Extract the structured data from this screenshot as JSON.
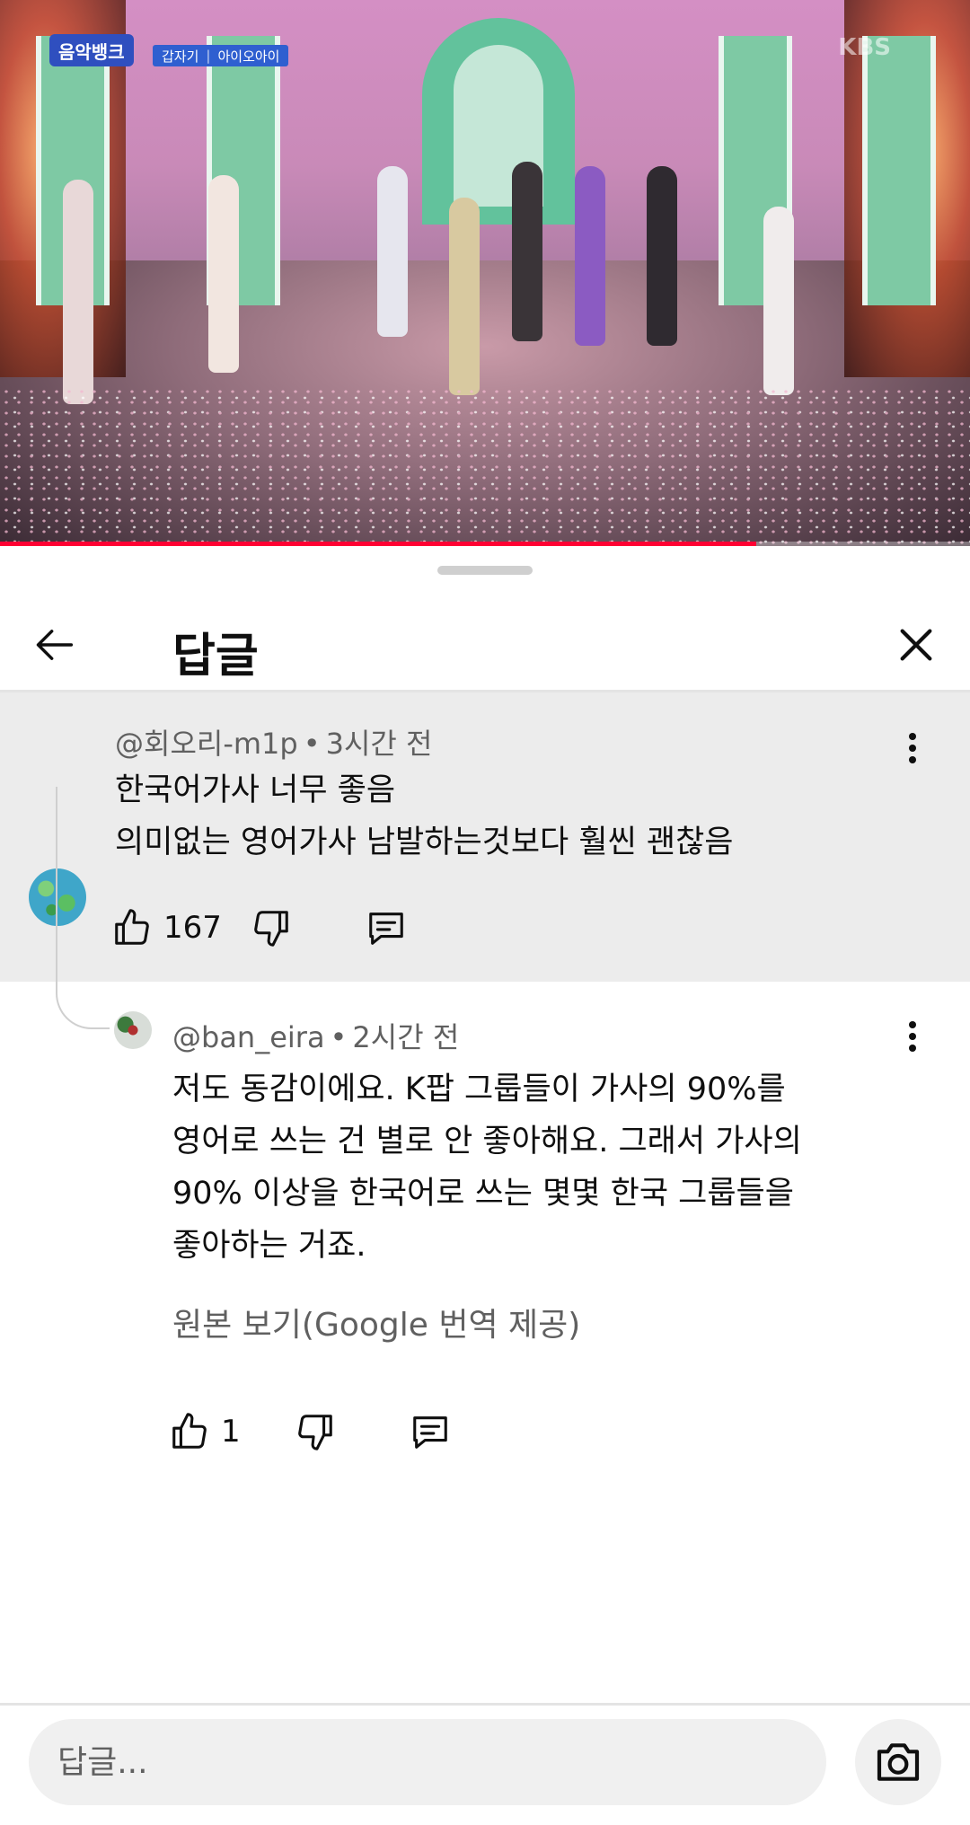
{
  "video": {
    "show_logo": "음악뱅크",
    "song_title": "갑자기",
    "artist": "아이오아이",
    "broadcaster": "KBS",
    "progress": 0.78
  },
  "sheet": {
    "title": "답글",
    "back_icon": "arrow-left-icon",
    "close_icon": "close-icon"
  },
  "parent_comment": {
    "author": "@회오리-m1p",
    "time": "3시간 전",
    "lines": [
      "한국어가사 너무 좋음",
      "의미없는 영어가사 남발하는것보다 훨씬 괜찮음"
    ],
    "likes": "167"
  },
  "reply": {
    "author": "@ban_eira",
    "time": "2시간 전",
    "lines": [
      "저도 동감이에요. K팝 그룹들이 가사의 90%를",
      "영어로 쓰는 건 별로 안 좋아해요. 그래서 가사의",
      "90% 이상을 한국어로 쓰는 몇몇 한국 그룹들을",
      "좋아하는 거죠."
    ],
    "translate_link": "원본 보기(Google 번역 제공)",
    "likes": "1"
  },
  "composer": {
    "placeholder": "답글...",
    "camera_icon": "camera-icon"
  },
  "colors": {
    "progress": "#ff0033",
    "parent_bg": "#ececec",
    "secondary_text": "#606060"
  }
}
